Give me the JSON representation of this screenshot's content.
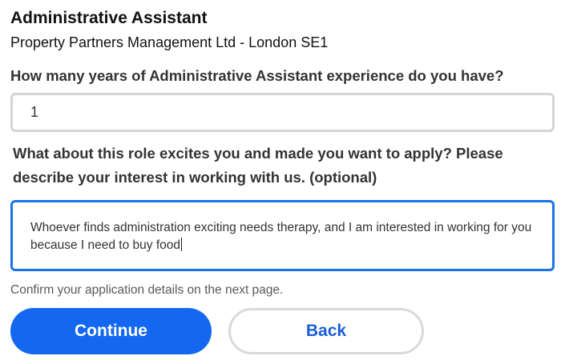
{
  "job": {
    "title": "Administrative Assistant",
    "company": "Property Partners Management Ltd - London SE1"
  },
  "questions": {
    "experience": {
      "label": "How many years of Administrative Assistant experience do you have?",
      "value": "1"
    },
    "interest": {
      "label": "What about this role excites you and made you want to apply? Please describe your interest in working with us. (optional)",
      "value": "Whoever finds administration exciting needs therapy, and I am interested in working for you because I need to buy food"
    }
  },
  "footer": {
    "note": "Confirm your application details on the next page.",
    "continue_label": "Continue",
    "back_label": "Back"
  },
  "colors": {
    "primary": "#1367f0",
    "focus_border": "#1a73e8",
    "input_border": "#d5d5d5"
  }
}
